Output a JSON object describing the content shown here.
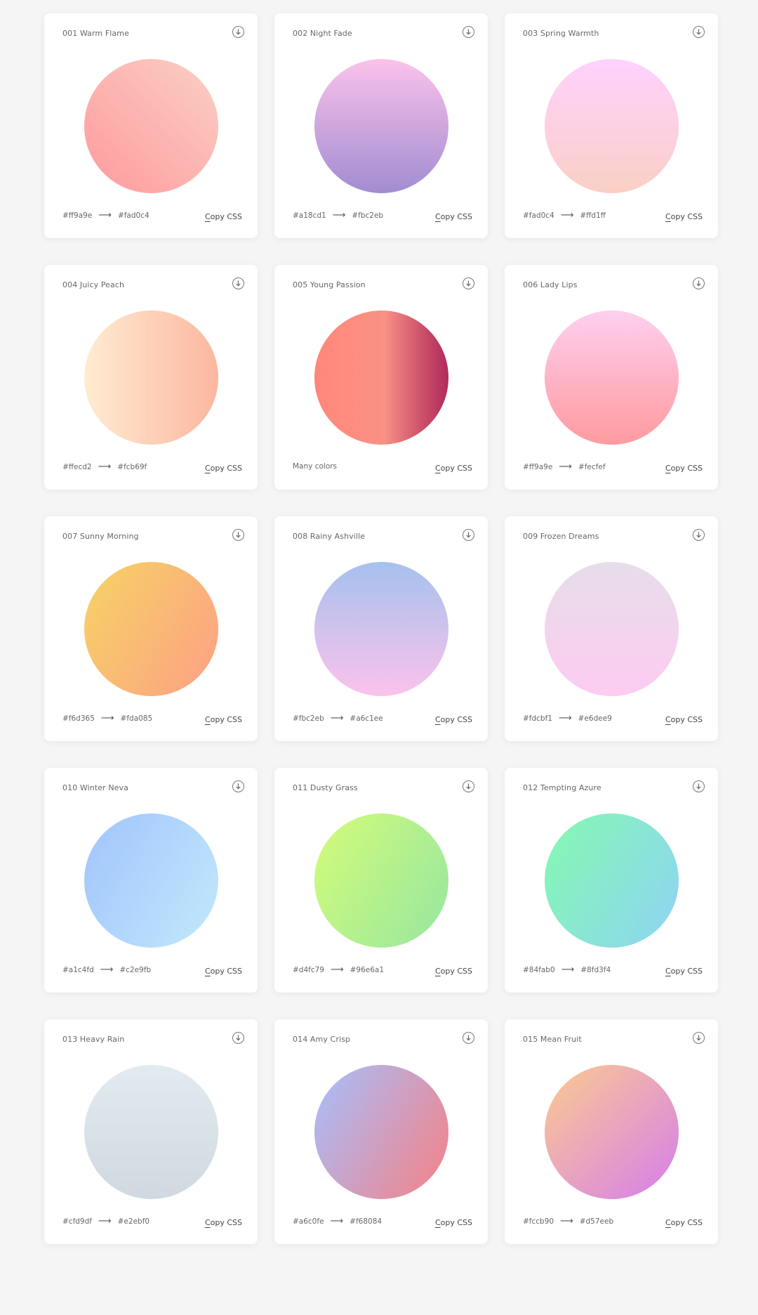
{
  "cards": [
    {
      "title": "001 Warm Flame",
      "from": "#ff9a9e",
      "to": "#fad0c4",
      "gradient": "linear-gradient(45deg, #ff9a9e 0%, #fad0c4 99%, #fad0c4 100%)"
    },
    {
      "title": "002 Night Fade",
      "from": "#a18cd1",
      "to": "#fbc2eb",
      "gradient": "linear-gradient(to top, #a18cd1 0%, #fbc2eb 100%)"
    },
    {
      "title": "003 Spring Warmth",
      "from": "#fad0c4",
      "to": "#ffd1ff",
      "gradient": "linear-gradient(to top, #fad0c4 0%, #ffd1ff 100%)"
    },
    {
      "title": "004 Juicy Peach",
      "from": "#ffecd2",
      "to": "#fcb69f",
      "gradient": "linear-gradient(to right, #ffecd2 0%, #fcb69f 100%)"
    },
    {
      "title": "005 Young Passion",
      "many": "Many colors",
      "gradient": "linear-gradient(to right, #ff8177 0%, #ff867a 0%, #ff8c7f 21%, #f99185 52%, #cf556c 78%, #b12a5b 100%)"
    },
    {
      "title": "006 Lady Lips",
      "from": "#ff9a9e",
      "to": "#fecfef",
      "gradient": "linear-gradient(to top, #ff9a9e 0%, #fecfef 99%, #fecfef 100%)"
    },
    {
      "title": "007 Sunny Morning",
      "from": "#f6d365",
      "to": "#fda085",
      "gradient": "linear-gradient(120deg, #f6d365 0%, #fda085 100%)"
    },
    {
      "title": "008 Rainy Ashville",
      "from": "#fbc2eb",
      "to": "#a6c1ee",
      "gradient": "linear-gradient(to top, #fbc2eb 0%, #a6c1ee 100%)"
    },
    {
      "title": "009 Frozen Dreams",
      "from": "#fdcbf1",
      "to": "#e6dee9",
      "gradient": "linear-gradient(to top, #fdcbf1 0%, #fdcbf1 1%, #e6dee9 100%)"
    },
    {
      "title": "010 Winter Neva",
      "from": "#a1c4fd",
      "to": "#c2e9fb",
      "gradient": "linear-gradient(120deg, #a1c4fd 0%, #c2e9fb 100%)"
    },
    {
      "title": "011 Dusty Grass",
      "from": "#d4fc79",
      "to": "#96e6a1",
      "gradient": "linear-gradient(120deg, #d4fc79 0%, #96e6a1 100%)"
    },
    {
      "title": "012 Tempting Azure",
      "from": "#84fab0",
      "to": "#8fd3f4",
      "gradient": "linear-gradient(120deg, #84fab0 0%, #8fd3f4 100%)"
    },
    {
      "title": "013 Heavy Rain",
      "from": "#cfd9df",
      "to": "#e2ebf0",
      "gradient": "linear-gradient(to top, #cfd9df 0%, #e2ebf0 100%)"
    },
    {
      "title": "014 Amy Crisp",
      "from": "#a6c0fe",
      "to": "#f68084",
      "gradient": "linear-gradient(120deg, #a6c0fe 0%, #f68084 100%)"
    },
    {
      "title": "015 Mean Fruit",
      "from": "#fccb90",
      "to": "#d57eeb",
      "gradient": "linear-gradient(135deg, #fccb90 0%, #d57eeb 100%)"
    }
  ],
  "copy_label_first": "C",
  "copy_label_rest": "opy CSS",
  "arrow": "⟶",
  "download_icon": "arrow-down-circle-icon"
}
